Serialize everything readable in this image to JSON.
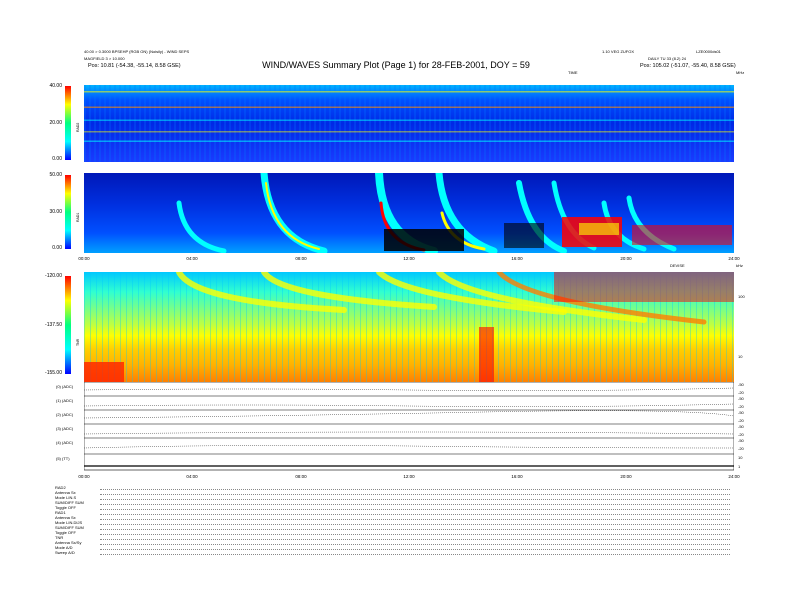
{
  "header": {
    "title": "WIND/WAVES Summary Plot (Page 1) for 28-FEB-2001, DOY = 59",
    "left_line1": "40.00 > 0.3000 BPSEHP (RGB ON) (Noisily) - WIND SEPS",
    "left_line2": "MAGFIELD 3 > 10.000",
    "left_pos": "Pos:   10.81 (-54.38, -55.14, 8.58 GSE)",
    "right_line1": "1.10 VEG ZUFOX",
    "right_line2": "DAILY TU 33 (8.2) 24",
    "right_id": "LZE0000ds01",
    "right_pos": "Pos:   105.02 (-51.07, -55.40, 8.58 GSE)",
    "rad2_mhz_label": "MHz",
    "mid_right_label": "TIME",
    "kHz_label": "kHz",
    "rad1_time_label": "DEVISE"
  },
  "panels": {
    "rad2": {
      "label": "RAD2",
      "yticks": [
        "40.00",
        "20.00",
        "0.00"
      ]
    },
    "rad1": {
      "label": "RAD1",
      "yticks": [
        "50.00",
        "30.00",
        "0.00"
      ]
    },
    "tnr": {
      "label": "TNR",
      "yticks": [
        "-120.00",
        "-137.50",
        "-155.00"
      ],
      "right_ticks": [
        "100",
        "10"
      ]
    }
  },
  "time_axis": [
    "00:00",
    "04:00",
    "08:00",
    "12:00",
    "16:00",
    "20:00",
    "24:00"
  ],
  "traces": [
    {
      "label": "(0) (ADC)",
      "right_ticks": [
        "-50",
        "-20"
      ]
    },
    {
      "label": "(1) (ADC)",
      "right_ticks": [
        "-50",
        "-20"
      ]
    },
    {
      "label": "(2) (ADC)",
      "right_ticks": [
        "-50",
        "-20"
      ]
    },
    {
      "label": "(3) (ADC)",
      "right_ticks": [
        "-50",
        "-20"
      ]
    },
    {
      "label": "(4) (ADC)",
      "right_ticks": [
        "-50",
        "-20"
      ]
    },
    {
      "label": "(5) (TT)",
      "right_ticks": [
        "10",
        "1"
      ]
    }
  ],
  "params": [
    "RAD2",
    "Antenna    Sx",
    "Mode   LIN.S",
    "SUM/DIFF  SUM",
    "Toggle    OFF",
    "RAD1",
    "Antenna    Sx",
    "Mode   LIN.DIJS",
    "SUM/DIFF SUM",
    "Toggle    OFF",
    "TNR",
    "Antenna   Sx/Sy",
    "Mode    A/D",
    "Sweep    A/D"
  ],
  "colors": {
    "low": "#00008b",
    "mid": "#00ffff",
    "high": "#ffff00",
    "max": "#ff0000"
  },
  "chart_data": [
    {
      "type": "heatmap",
      "name": "RAD2",
      "ylim": [
        0,
        40
      ],
      "xlim": [
        "00:00",
        "24:00"
      ]
    },
    {
      "type": "heatmap",
      "name": "RAD1",
      "ylim": [
        0,
        50
      ],
      "xlim": [
        "00:00",
        "24:00"
      ]
    },
    {
      "type": "heatmap",
      "name": "TNR",
      "ylim": [
        -155,
        -120
      ],
      "xlim": [
        "00:00",
        "24:00"
      ]
    }
  ]
}
